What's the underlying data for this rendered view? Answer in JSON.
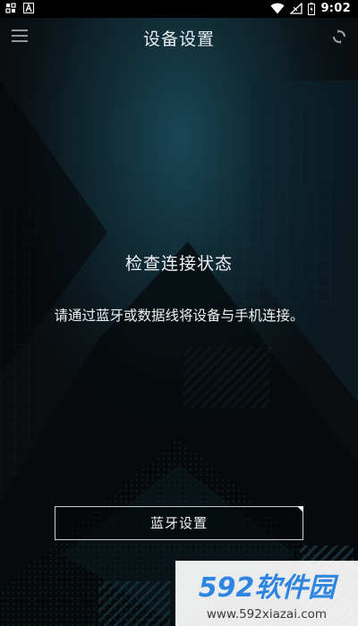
{
  "status_bar": {
    "time": "9:02",
    "icons": [
      "notification-icon",
      "a-icon",
      "wifi-icon",
      "no-sim-icon",
      "battery-icon"
    ]
  },
  "app_bar": {
    "title": "设备设置",
    "menu_icon": "menu-icon",
    "sync_icon": "sync-icon"
  },
  "main": {
    "heading": "检查连接状态",
    "description": "请通过蓝牙或数据线将设备与手机连接。",
    "bluetooth_button": "蓝牙设置"
  },
  "watermark": {
    "logo": "592软件园",
    "url": "www.592xiazai.com"
  },
  "colors": {
    "background": "#0a0d10",
    "accent_teal": "#123845",
    "text": "#f0f3f5",
    "watermark_blue": "#2f86e0"
  }
}
